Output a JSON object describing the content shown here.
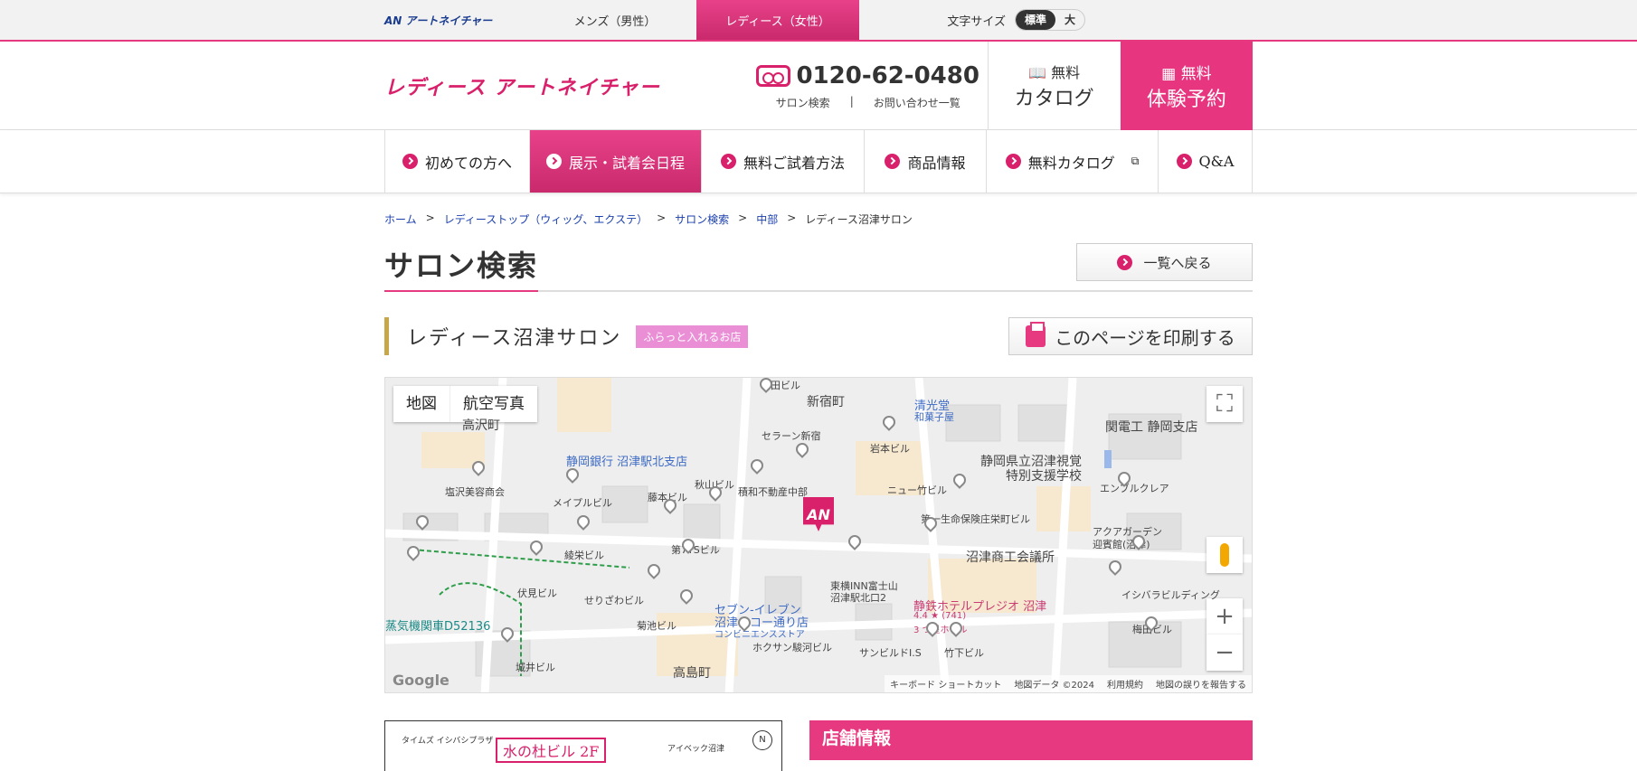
{
  "topbar": {
    "brand": "アートネイチャー",
    "brand_mark": "AN",
    "tabs": [
      {
        "label": "メンズ（男性）",
        "active": false
      },
      {
        "label": "レディース（女性）",
        "active": true
      }
    ],
    "font_size_label": "文字サイズ",
    "font_size_options": [
      "標準",
      "大"
    ],
    "font_size_selected": "標準"
  },
  "header": {
    "logo": "レディース アートネイチャー",
    "phone": "0120-62-0480",
    "phone_links": [
      "サロン検索",
      "|",
      "お問い合わせ一覧"
    ],
    "catalog_small": "無料",
    "catalog_big": "カタログ",
    "trial_small": "無料",
    "trial_big": "体験予約"
  },
  "nav": [
    {
      "label": "初めての方へ",
      "active": false
    },
    {
      "label": "展示・試着会日程",
      "active": true
    },
    {
      "label": "無料ご試着方法",
      "active": false
    },
    {
      "label": "商品情報",
      "active": false
    },
    {
      "label": "無料カタログ",
      "active": false,
      "external": true
    },
    {
      "label": "Q&A",
      "active": false
    }
  ],
  "breadcrumb": [
    "ホーム",
    "レディーストップ（ウィッグ、エクステ）",
    "サロン検索",
    "中部",
    "レディース沼津サロン"
  ],
  "page": {
    "title": "サロン検索",
    "back_button": "一覧へ戻る",
    "salon_name": "レディース沼津サロン",
    "salon_badge": "ふらっと入れるお店",
    "print_button": "このページを印刷する"
  },
  "map": {
    "types": [
      "地図",
      "航空写真"
    ],
    "selected_type": "地図",
    "labels": {
      "shinjuku": "新宿町",
      "takazawa": "高沢町",
      "shizuoka_bank": "静岡銀行 沼津駅北支店",
      "seikodo": "清光堂",
      "seikodo_sub": "和菓子屋",
      "kanden": "関電工 静岡支店",
      "school": "静岡県立沼津視覚",
      "school2": "特別支援学校",
      "ishida": "石田ビル",
      "seran": "セラーン新宿",
      "iwamoto": "岩本ビル",
      "akiyama": "秋山ビル",
      "sekiwa": "積和不動産中部",
      "fujimoto": "藤本ビル",
      "meiple": "メイプルビル",
      "shiozawa": "塩沢美容商会",
      "newtake": "ニュー竹ビル",
      "enbl": "エンブルクレア",
      "daiichi": "第一生命保険庄栄町ビル",
      "aqua": "アクアガーデン",
      "aqua2": "迎賓館(沼津)",
      "shoko": "沼津商工会議所",
      "ryoei": "綾栄ビル",
      "dai7ts": "第7TSビル",
      "toyoko": "東横INN富士山",
      "toyoko2": "沼津駅北口2",
      "hotel": "静鉄ホテルプレジオ 沼津",
      "hotel_rating": "4.4 ★ (741)",
      "hotel_type": "3 つ星ホテル",
      "ishibashi": "イシバラビルディング",
      "fushimi": "伏見ビル",
      "serizawa": "せりざわビル",
      "seven": "セブン-イレブン",
      "seven2": "沼津リコー通り店",
      "seven3": "コンビニエンスストア",
      "kikuike": "菊池ビル",
      "steam": "蒸気機関車D52136",
      "hokusan": "ホクサン駿河ビル",
      "sanbild": "サンビルドI.S",
      "takeshita": "竹下ビル",
      "umeda": "梅田ビル",
      "takashima": "高島町",
      "shiroi": "城井ビル"
    },
    "footer": [
      "キーボード ショートカット",
      "地図データ ©2024",
      "利用規約",
      "地図の誤りを報告する"
    ],
    "google": "Google",
    "marker": "AN"
  },
  "floorplan": {
    "building": "水の杜ビル 2F",
    "left": "タイムズ イシバシプラザ",
    "right": "アイベック沼津",
    "north": "N"
  },
  "shop_info_heading": "店舗情報"
}
